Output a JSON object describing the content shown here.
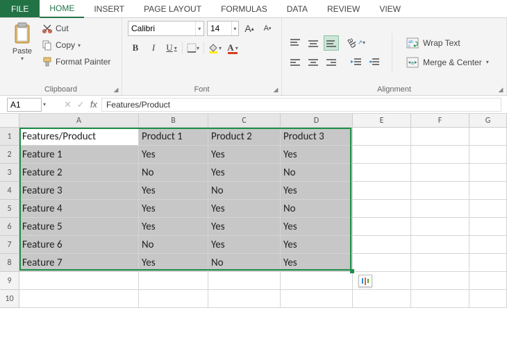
{
  "tabs": {
    "file": "FILE",
    "items": [
      "HOME",
      "INSERT",
      "PAGE LAYOUT",
      "FORMULAS",
      "DATA",
      "REVIEW",
      "VIEW"
    ],
    "active": "HOME"
  },
  "ribbon": {
    "clipboard": {
      "paste": "Paste",
      "cut": "Cut",
      "copy": "Copy",
      "format_painter": "Format Painter",
      "group_label": "Clipboard"
    },
    "font": {
      "name": "Calibri",
      "size": "14",
      "group_label": "Font"
    },
    "alignment": {
      "wrap": "Wrap Text",
      "merge": "Merge & Center",
      "group_label": "Alignment"
    }
  },
  "namebox": "A1",
  "formula_bar": "Features/Product",
  "grid": {
    "columns": [
      "A",
      "B",
      "C",
      "D",
      "E",
      "F",
      "G"
    ],
    "selected_cols": [
      "A",
      "B",
      "C",
      "D"
    ],
    "selected_rows": [
      1,
      2,
      3,
      4,
      5,
      6,
      7,
      8
    ],
    "active_cell": "A1",
    "rows": [
      {
        "r": 1,
        "cells": [
          "Features/Product",
          "Product 1",
          "Product 2",
          "Product 3",
          "",
          "",
          ""
        ]
      },
      {
        "r": 2,
        "cells": [
          "Feature 1",
          "Yes",
          "Yes",
          "Yes",
          "",
          "",
          ""
        ]
      },
      {
        "r": 3,
        "cells": [
          "Feature 2",
          "No",
          "Yes",
          "No",
          "",
          "",
          ""
        ]
      },
      {
        "r": 4,
        "cells": [
          "Feature 3",
          "Yes",
          "No",
          "Yes",
          "",
          "",
          ""
        ]
      },
      {
        "r": 5,
        "cells": [
          "Feature 4",
          "Yes",
          "Yes",
          "No",
          "",
          "",
          ""
        ]
      },
      {
        "r": 6,
        "cells": [
          "Feature 5",
          "Yes",
          "Yes",
          "Yes",
          "",
          "",
          ""
        ]
      },
      {
        "r": 7,
        "cells": [
          "Feature 6",
          "No",
          "Yes",
          "Yes",
          "",
          "",
          ""
        ]
      },
      {
        "r": 8,
        "cells": [
          "Feature 7",
          "Yes",
          "No",
          "Yes",
          "",
          "",
          ""
        ]
      },
      {
        "r": 9,
        "cells": [
          "",
          "",
          "",
          "",
          "",
          "",
          ""
        ]
      },
      {
        "r": 10,
        "cells": [
          "",
          "",
          "",
          "",
          "",
          "",
          ""
        ]
      }
    ]
  }
}
